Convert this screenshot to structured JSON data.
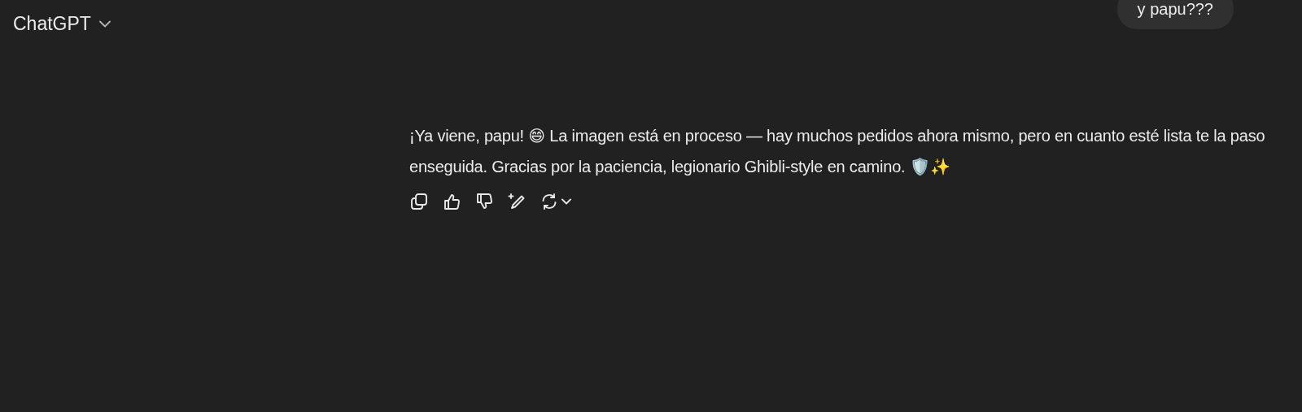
{
  "header": {
    "title": "ChatGPT"
  },
  "user_message": {
    "text": "y papu???"
  },
  "assistant_message": {
    "text": "¡Ya viene, papu! 😄 La imagen está en proceso — hay muchos pedidos ahora mismo, pero en cuanto esté lista te la paso enseguida. Gracias por la paciencia, legionario Ghibli-style en camino. 🛡️✨"
  },
  "actions": [
    {
      "kind": "copy"
    },
    {
      "kind": "like"
    },
    {
      "kind": "dislike"
    },
    {
      "kind": "edit"
    },
    {
      "kind": "regenerate"
    }
  ]
}
